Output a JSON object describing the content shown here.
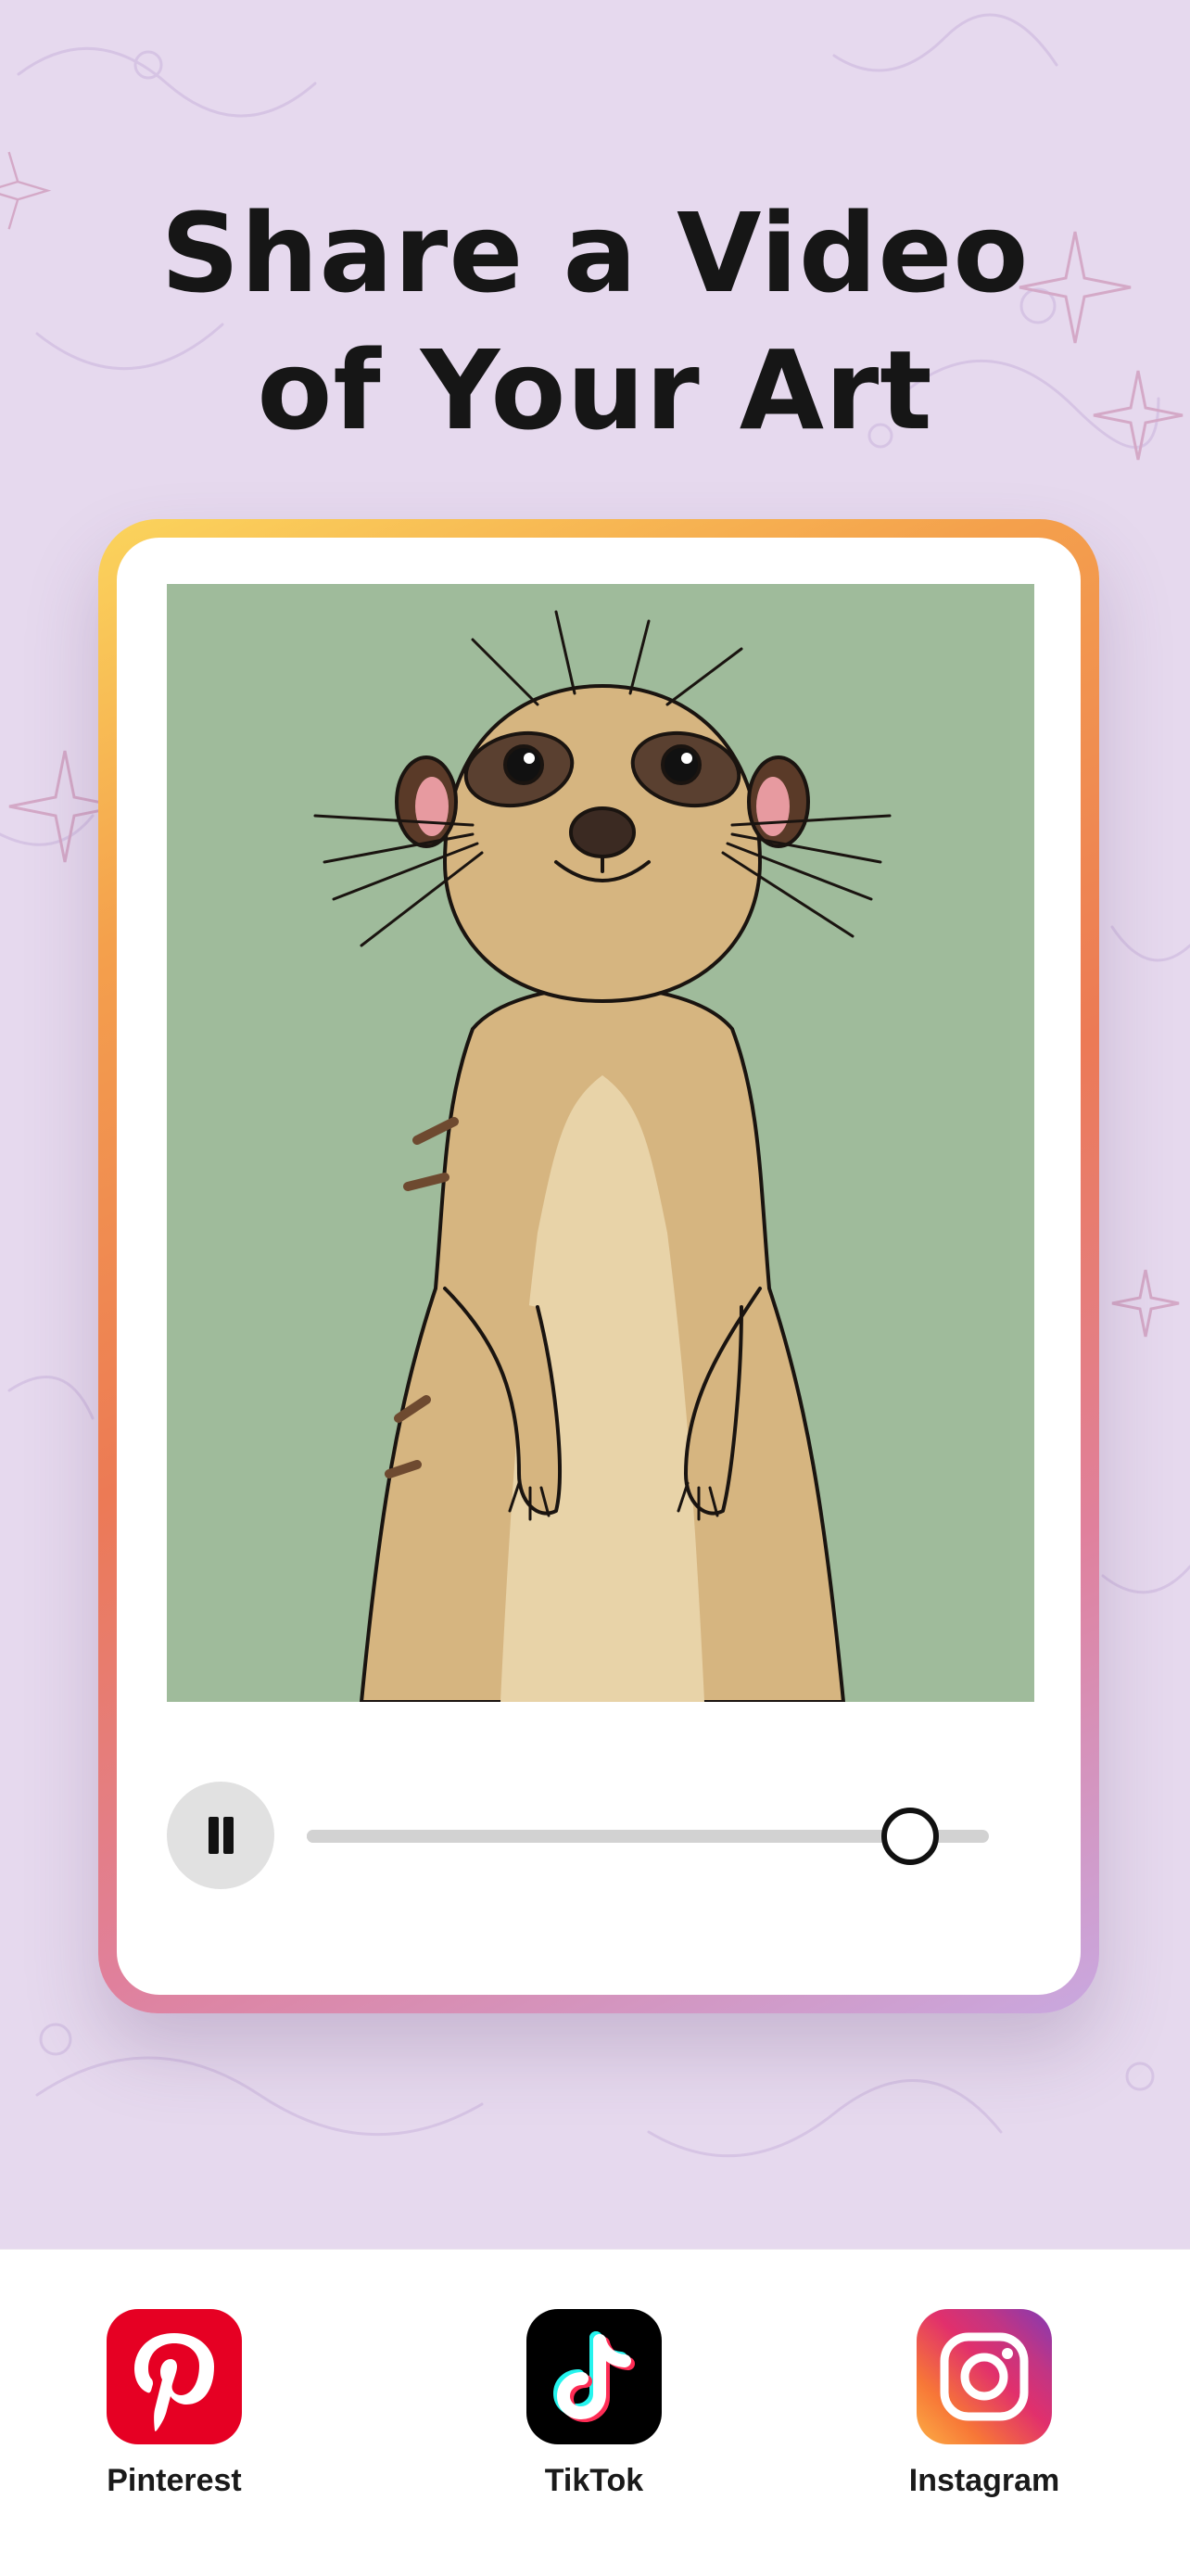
{
  "header": {
    "title_line1": "Share a Video",
    "title_line2": "of Your Art"
  },
  "player": {
    "artwork": "meerkat-illustration",
    "playback_state": "playing",
    "control_icon": "pause-icon",
    "progress_fraction": 0.88
  },
  "share": {
    "items": [
      {
        "label": "Pinterest",
        "icon": "pinterest-icon",
        "color": "#e60023"
      },
      {
        "label": "TikTok",
        "icon": "tiktok-icon",
        "color": "#000000"
      },
      {
        "label": "Instagram",
        "icon": "instagram-icon",
        "color": "#e1306c"
      }
    ]
  },
  "colors": {
    "background": "#e6d9ee",
    "artwork_background": "#9fbb9b",
    "card_border_gradient": [
      "#fbd45c",
      "#ec7a55",
      "#c9a8e0"
    ]
  }
}
